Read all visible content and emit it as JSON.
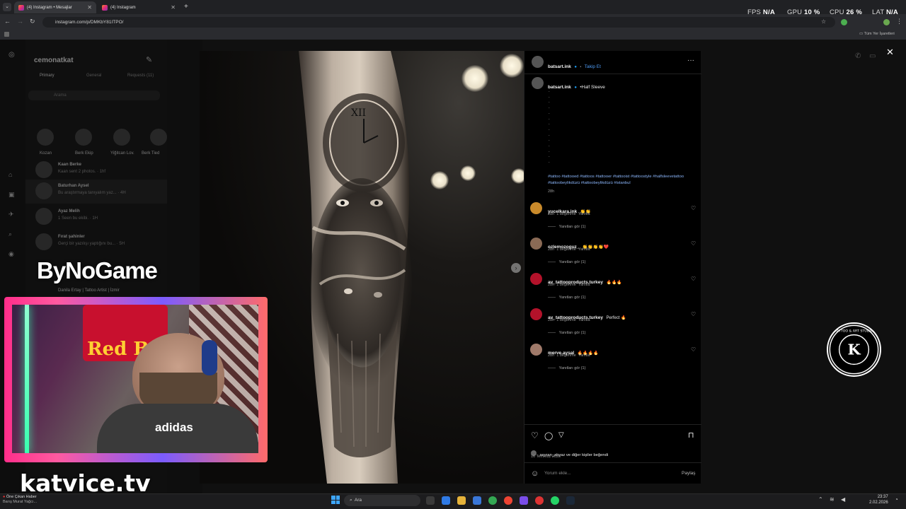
{
  "browser": {
    "tabs": [
      {
        "label": "(4) Instagram • Mesajlar"
      },
      {
        "label": "(4) Instagram"
      }
    ],
    "url": "instagram.com/p/DMKbY81ITPO/",
    "bookmarks_label": "Tüm Yer İşaretleri"
  },
  "overlay_stats": {
    "fps_label": "FPS",
    "fps_value": "N/A",
    "gpu_label": "GPU",
    "gpu_value": "10 %",
    "cpu_label": "CPU",
    "cpu_value": "26 %",
    "lat_label": "LAT",
    "lat_value": "N/A"
  },
  "dm": {
    "account": "cemonatkat",
    "tabs": [
      "Primary",
      "General",
      "Requests (11)"
    ],
    "search_placeholder": "Arama",
    "stories": [
      "Kozan",
      "Berk Ekip",
      "Yiğitcan Lov.",
      "Berk Tied"
    ],
    "conversations": [
      {
        "name": "Kaan Berke",
        "preview": "Kaan sent 2 photos. · 1hf"
      },
      {
        "name": "Baturhan Aysel",
        "preview": "Bu araştırmaya tanıyalım yaz... · 4H"
      },
      {
        "name": "Ayaz Melih",
        "preview": "1 Seen bu ekibi. · 1H"
      },
      {
        "name": "Fırat şahinler",
        "preview": "Gerçi bir yazılışı yaptığını bu... · 5H"
      },
      {
        "name": "Danila Ertay | Tattoo Artist | İzmir",
        "preview": ""
      }
    ]
  },
  "post": {
    "author": "batsart.ink",
    "follow_label": "Takip Et",
    "caption_prefix": "•Half Sleeve",
    "hashtags": "#tattoo #tattooed #tattoos #tattooer #tattooist #tattoostyle #halfsleevetattoo #tattoobeylikdüzü #tattoobeylikdüzü #istanbul",
    "caption_age": "28h",
    "comments": [
      {
        "user": "yucelkara.ink",
        "text": "👏👏",
        "age": "28h",
        "likes": "1 beğenme",
        "reply": "Yanıtla",
        "replies": "Yanıtları gör (1)",
        "avatar_color": "#c98a2b"
      },
      {
        "user": "ozlemozoguz_",
        "text": "👏👏👏👏❤️",
        "age": "28h",
        "likes": "1 beğenme",
        "reply": "Yanıtla",
        "replies": "Yanıtları gör (1)",
        "avatar_color": "#8a6a55"
      },
      {
        "user": "av_tattooproducts.turkey",
        "text": "🔥🔥🔥",
        "age": "28h",
        "likes": "1 beğenme",
        "reply": "Yanıtla",
        "replies": "Yanıtları gör (1)",
        "avatar_color": "#b3122a"
      },
      {
        "user": "av_tattooproducts.turkey",
        "text": "Perfect 🔥",
        "age": "28h",
        "likes": "1 beğenme",
        "reply": "Yanıtla",
        "replies": "Yanıtları gör (1)",
        "avatar_color": "#b3122a"
      },
      {
        "user": "merve.aysal",
        "text": "🔥🔥🔥🔥",
        "age": "28h",
        "likes": "1 beğenme",
        "reply": "Yanıtla",
        "replies": "Yanıtları gör (1)",
        "avatar_color": "#a07a6a"
      }
    ],
    "liked_by": "seyran_akyaz ve diğer kişiler beğendi",
    "date": "16 Temmuz 2025",
    "comment_placeholder": "Yorum ekle...",
    "share_label": "Paylaş"
  },
  "stream": {
    "sponsor": "ByNoGame",
    "site": "katvice.tv",
    "logo_text": "TATTOO & ART STUDIO",
    "cam_brand_1": "Red Bull",
    "cam_brand_2": "adidas"
  },
  "taskbar": {
    "notification_title": "Öne Çıkan Haber",
    "notification_text": "Barış Murat Yağcı...",
    "search_label": "Ara",
    "time": "23:37",
    "date": "2.02.2026"
  }
}
